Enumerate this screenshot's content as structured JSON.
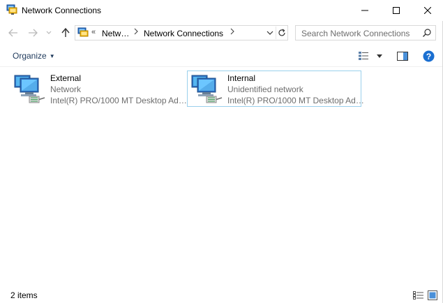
{
  "window": {
    "title": "Network Connections",
    "icon": "network-connections-icon"
  },
  "address": {
    "overflow": "«",
    "segments": [
      "Netw…",
      "Network Connections"
    ],
    "search_placeholder": "Search Network Connections"
  },
  "commands": {
    "organize_label": "Organize"
  },
  "connections": [
    {
      "name": "External",
      "status": "Network",
      "device": "Intel(R) PRO/1000 MT Desktop Ad…",
      "icon": "network-adapter-icon",
      "selected": false
    },
    {
      "name": "Internal",
      "status": "Unidentified network",
      "device": "Intel(R) PRO/1000 MT Desktop Ad…",
      "icon": "network-adapter-icon",
      "selected": true
    }
  ],
  "status_bar": {
    "item_count": "2 items"
  },
  "colors": {
    "selection_border": "#9ad0ec",
    "help_blue": "#1a6fd1",
    "link_text": "#1e395b"
  }
}
